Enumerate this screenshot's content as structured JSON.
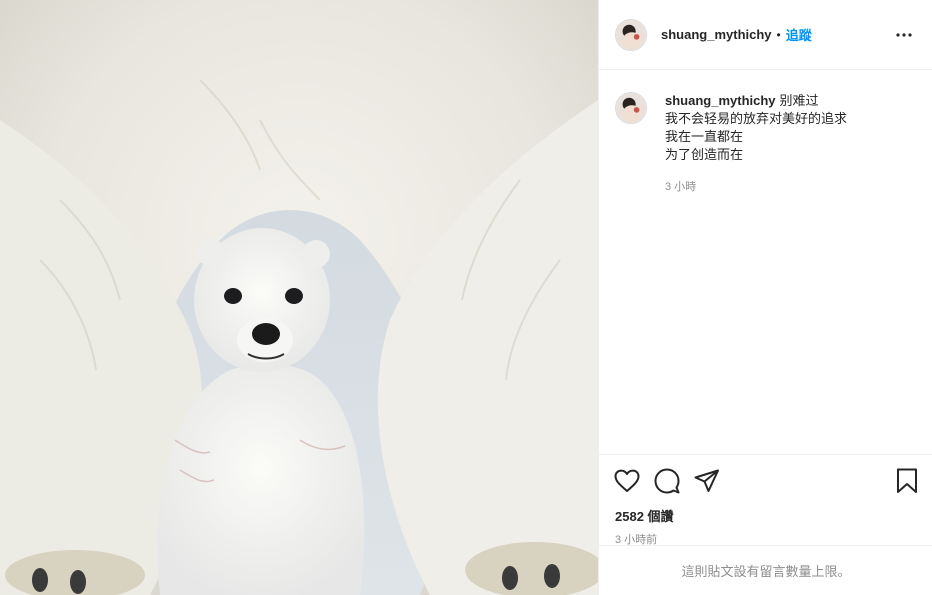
{
  "header": {
    "username": "shuang_mythichy",
    "separator": "•",
    "follow_label": "追蹤"
  },
  "caption": {
    "username": "shuang_mythichy",
    "lines": [
      "别难过",
      "我不会轻易的放弃对美好的追求",
      "我在一直都在",
      "为了创造而在"
    ],
    "time": "3 小時"
  },
  "actions": {
    "icons": [
      "heart-icon",
      "comment-icon",
      "share-icon",
      "bookmark-icon"
    ]
  },
  "likes": {
    "count": "2582",
    "suffix": "個讚"
  },
  "post_time": "3 小時前",
  "comments_disabled_text": "這則貼文設有留言數量上限。",
  "colors": {
    "accent": "#0095f6",
    "muted": "#8e8e8e",
    "divider": "#efefef"
  }
}
